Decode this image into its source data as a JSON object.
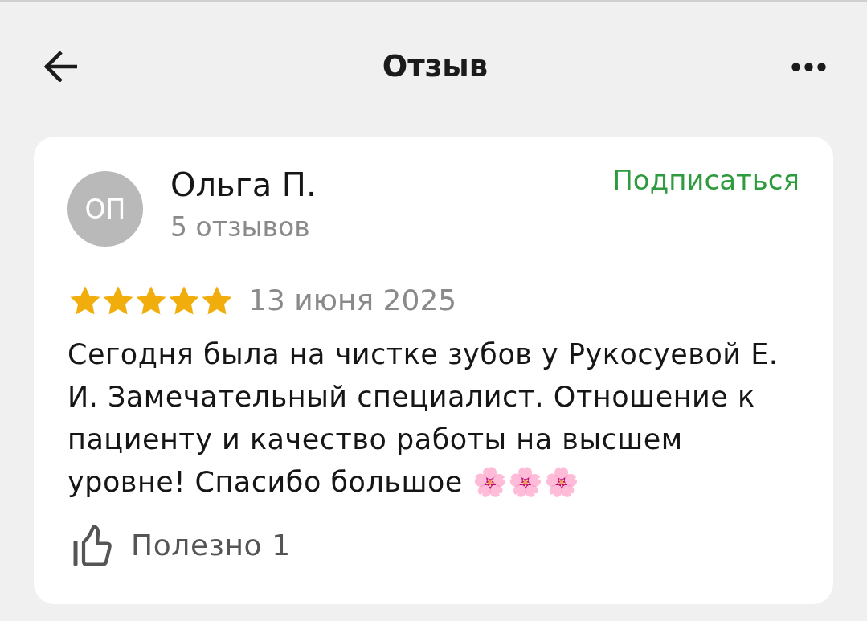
{
  "header": {
    "title": "Отзыв"
  },
  "review": {
    "author": {
      "initials": "ОП",
      "name": "Ольга П.",
      "reviews_count": "5 отзывов"
    },
    "subscribe_label": "Подписаться",
    "stars": 5,
    "date": "13 июня 2025",
    "text": "Сегодня была на чистке зубов у Рукосуевой Е. И. Замечательный специалист. Отношение к пациенту и качество работы на высшем уровне! Спасибо большое 🌸🌸🌸",
    "helpful": {
      "label": "Полезно",
      "count": "1"
    }
  }
}
